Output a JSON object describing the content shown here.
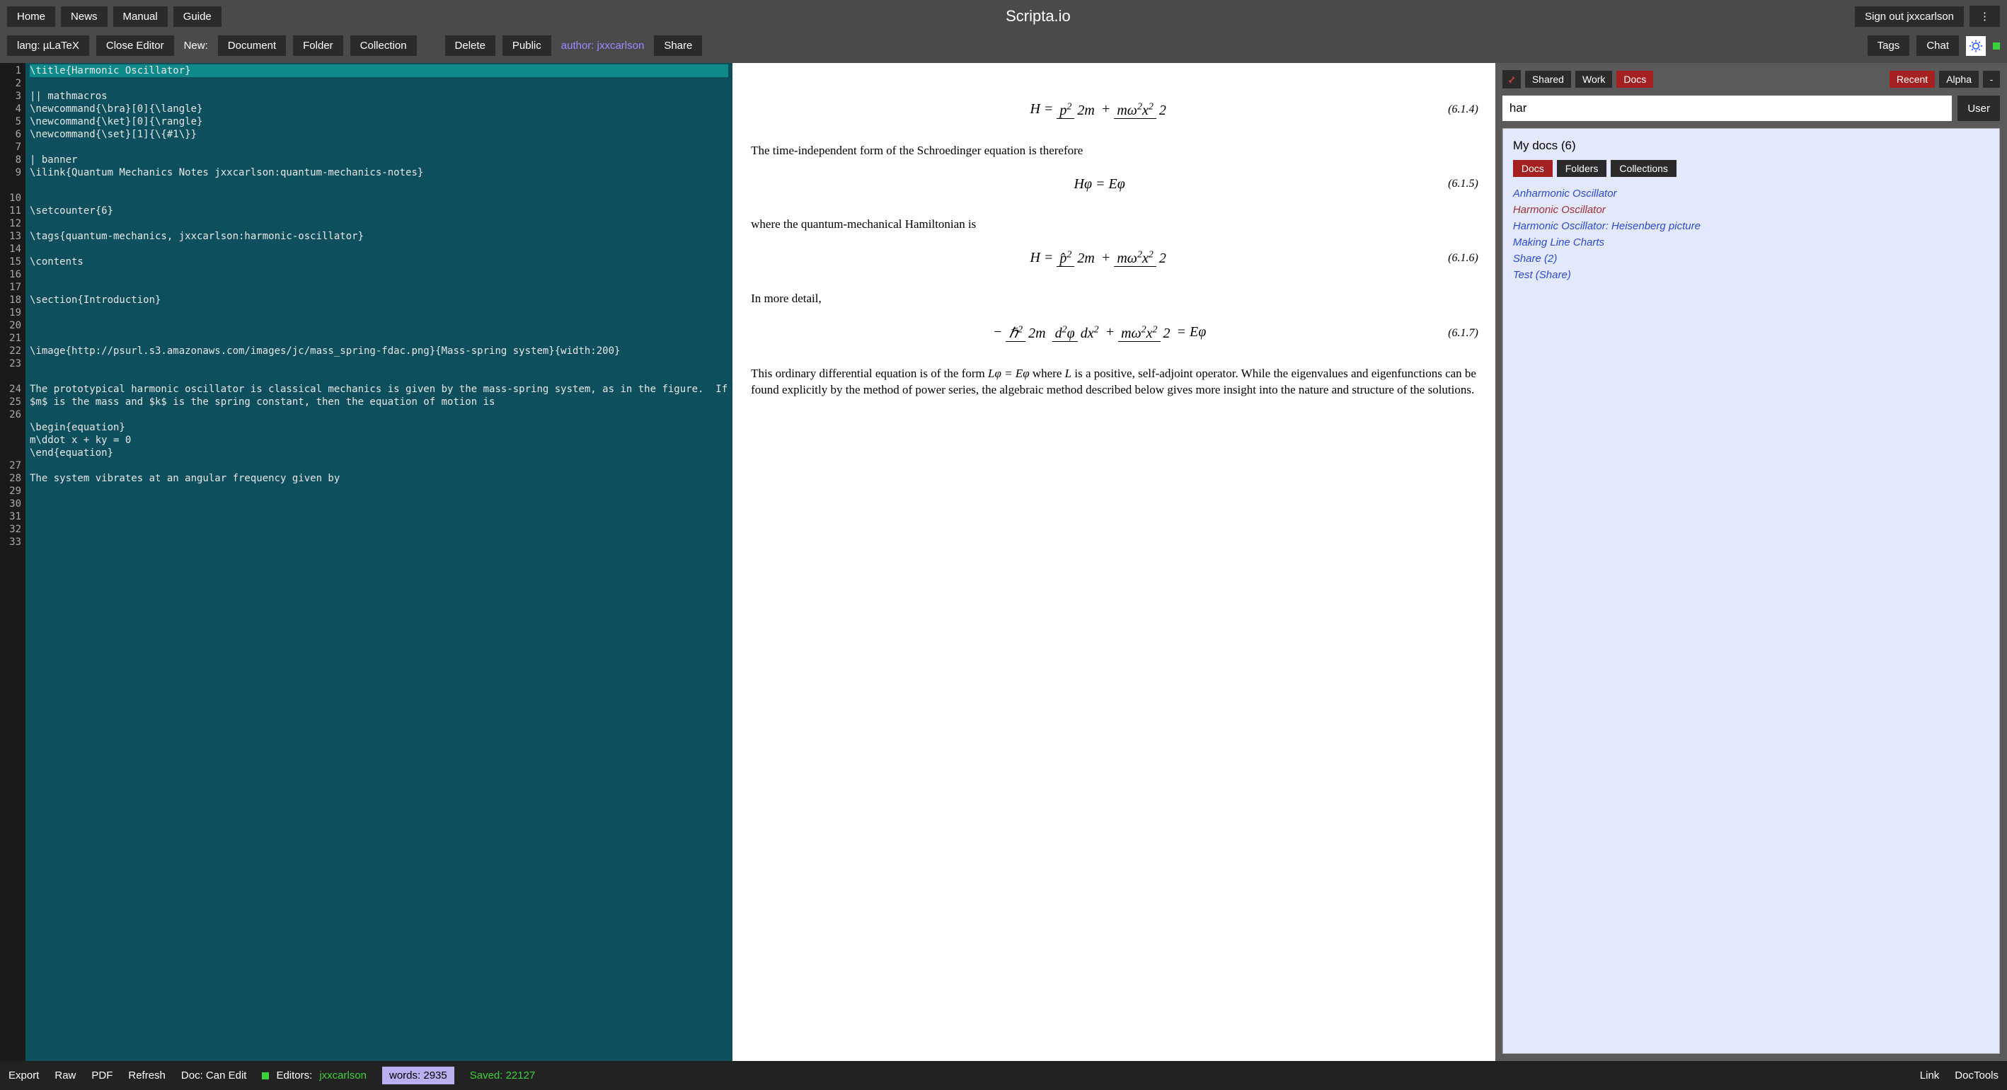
{
  "app_title": "Scripta.io",
  "toolbar1": {
    "home": "Home",
    "news": "News",
    "manual": "Manual",
    "guide": "Guide",
    "signout": "Sign out jxxcarlson",
    "menu": "⋮"
  },
  "toolbar2": {
    "lang": "lang: µLaTeX",
    "close_editor": "Close Editor",
    "new_label": "New:",
    "document": "Document",
    "folder": "Folder",
    "collection": "Collection",
    "delete": "Delete",
    "public": "Public",
    "author": "author: jxxcarlson",
    "share": "Share",
    "tags": "Tags",
    "chat": "Chat"
  },
  "editor": {
    "lines": [
      {
        "n": 1,
        "t": "\\title{Harmonic Oscillator}",
        "hl": true
      },
      {
        "n": 2,
        "t": ""
      },
      {
        "n": 3,
        "t": "|| mathmacros"
      },
      {
        "n": 4,
        "t": "\\newcommand{\\bra}[0]{\\langle}"
      },
      {
        "n": 5,
        "t": "\\newcommand{\\ket}[0]{\\rangle}"
      },
      {
        "n": 6,
        "t": "\\newcommand{\\set}[1]{\\{#1\\}}"
      },
      {
        "n": 7,
        "t": ""
      },
      {
        "n": 8,
        "t": "| banner"
      },
      {
        "n": 9,
        "t": "\\ilink{Quantum Mechanics Notes jxxcarlson:quantum-mechanics-notes}",
        "wrap": true
      },
      {
        "n": 10,
        "t": ""
      },
      {
        "n": 11,
        "t": ""
      },
      {
        "n": 12,
        "t": "\\setcounter{6}"
      },
      {
        "n": 13,
        "t": ""
      },
      {
        "n": 14,
        "t": "\\tags{quantum-mechanics, jxxcarlson:harmonic-oscillator}"
      },
      {
        "n": 15,
        "t": ""
      },
      {
        "n": 16,
        "t": "\\contents"
      },
      {
        "n": 17,
        "t": ""
      },
      {
        "n": 18,
        "t": ""
      },
      {
        "n": 19,
        "t": "\\section{Introduction}"
      },
      {
        "n": 20,
        "t": ""
      },
      {
        "n": 21,
        "t": ""
      },
      {
        "n": 22,
        "t": ""
      },
      {
        "n": 23,
        "t": "\\image{http://psurl.s3.amazonaws.com/images/jc/mass_spring-fdac.png}{Mass-spring system}{width:200}",
        "wrap": true
      },
      {
        "n": 24,
        "t": ""
      },
      {
        "n": 25,
        "t": ""
      },
      {
        "n": 26,
        "t": "The prototypical harmonic oscillator is classical mechanics is given by the mass-spring system, as in the figure.  If $m$ is the mass and $k$ is the spring constant, then the equation of motion is",
        "wrap": true
      },
      {
        "n": 27,
        "t": ""
      },
      {
        "n": 28,
        "t": "\\begin{equation}"
      },
      {
        "n": 29,
        "t": "m\\ddot x + ky = 0"
      },
      {
        "n": 30,
        "t": "\\end{equation}"
      },
      {
        "n": 31,
        "t": ""
      },
      {
        "n": 32,
        "t": "The system vibrates at an angular frequency given by"
      },
      {
        "n": 33,
        "t": ""
      }
    ]
  },
  "preview": {
    "eq1_num": "(6.1.4)",
    "p1": "The time-independent form of the Schroedinger equation is therefore",
    "eq2": "Hφ = Eφ",
    "eq2_num": "(6.1.5)",
    "p2": "where the quantum-mechanical Hamiltonian is",
    "eq3_num": "(6.1.6)",
    "p3": "In more detail,",
    "eq4_num": "(6.1.7)",
    "p4a": "This ordinary differential equation is of the form ",
    "p4b": "Lφ = Eφ",
    "p4c": " where ",
    "p4d": "L",
    "p4e": " is a positive, self-adjoint operator. While the eigenvalues and eigenfunctions can be found explicitly by the method of power series, the algebraic method described below gives more insight into the nature and structure of the solutions."
  },
  "right": {
    "shared": "Shared",
    "work": "Work",
    "docs": "Docs",
    "recent": "Recent",
    "alpha": "Alpha",
    "dash": "-",
    "search_value": "har",
    "user_btn": "User",
    "panel_title": "My docs (6)",
    "tab_docs": "Docs",
    "tab_folders": "Folders",
    "tab_collections": "Collections",
    "doclist": [
      {
        "label": "Anharmonic Oscillator",
        "active": false
      },
      {
        "label": "Harmonic Oscillator",
        "active": true
      },
      {
        "label": "Harmonic Oscillator: Heisenberg picture",
        "active": false
      },
      {
        "label": "Making Line Charts",
        "active": false
      },
      {
        "label": "Share (2)",
        "active": false
      },
      {
        "label": "Test (Share)",
        "active": false
      }
    ]
  },
  "status": {
    "export": "Export",
    "raw": "Raw",
    "pdf": "PDF",
    "refresh": "Refresh",
    "doc_can_edit": "Doc: Can Edit",
    "editors_label": "Editors:",
    "editors_value": "jxxcarlson",
    "words": "words: 2935",
    "saved": "Saved: 22127",
    "link": "Link",
    "doctools": "DocTools"
  }
}
